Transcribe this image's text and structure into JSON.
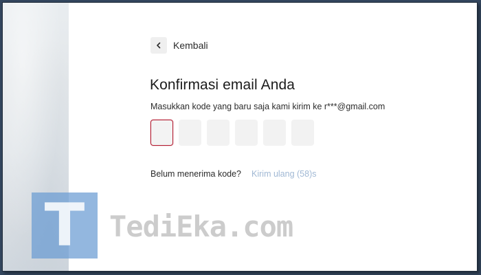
{
  "nav": {
    "back_label": "Kembali",
    "back_icon": "chevron-left-icon"
  },
  "confirm": {
    "title": "Konfirmasi email Anda",
    "instruction": "Masukkan kode yang baru saja kami kirim ke r***@gmail.com",
    "code_length": 6,
    "code_values": [
      "",
      "",
      "",
      "",
      "",
      ""
    ],
    "active_index": 0
  },
  "resend": {
    "question": "Belum menerima kode?",
    "link_label": "Kirim ulang (58)s"
  },
  "colors": {
    "active_border": "#b21b30",
    "link": "#a0b8d4",
    "watermark_logo": "#699bd2"
  },
  "watermark": {
    "logo_letter": "T",
    "text": "TediEka.com"
  }
}
